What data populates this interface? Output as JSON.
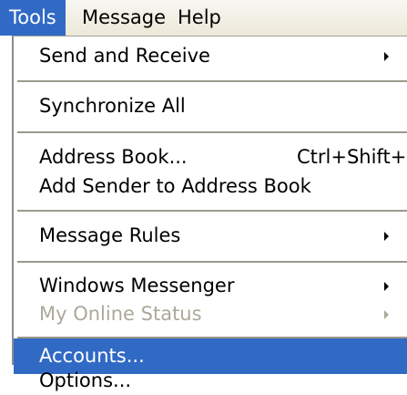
{
  "colors": {
    "menubar_background": "#ece9d8",
    "highlight": "#316ac5",
    "highlight_text": "#ffffff",
    "disabled_text": "#aca899",
    "separator": "#9c9a8c"
  },
  "menubar": {
    "items": [
      {
        "label": "Tools",
        "active": true
      },
      {
        "label": "Message",
        "active": false
      },
      {
        "label": "Help",
        "active": false
      }
    ]
  },
  "tools_menu": {
    "items": [
      {
        "label": "Send and Receive",
        "submenu_icon": "chevron-right-icon"
      },
      {
        "label": "Synchronize All"
      },
      {
        "label": "Address Book...",
        "shortcut": "Ctrl+Shift+B"
      },
      {
        "label": "Add Sender to Address Book"
      },
      {
        "label": "Message Rules",
        "submenu_icon": "chevron-right-icon"
      },
      {
        "label": "Windows Messenger",
        "submenu_icon": "chevron-right-icon"
      },
      {
        "label": "My Online Status",
        "submenu_icon": "chevron-right-icon",
        "disabled": true
      },
      {
        "label": "Accounts...",
        "highlighted": true
      },
      {
        "label": "Options..."
      }
    ]
  }
}
